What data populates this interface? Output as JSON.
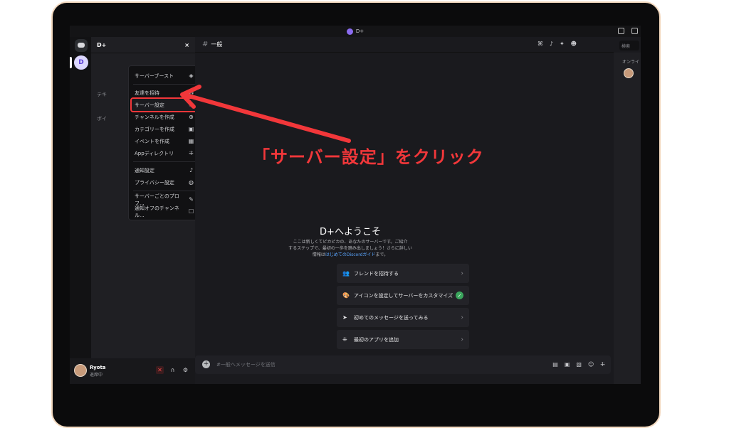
{
  "window": {
    "title": "D+"
  },
  "rail": {
    "server_initial": "D"
  },
  "sidebar": {
    "server_name": "D+",
    "close_glyph": "×",
    "ghost_text_category": "テキ",
    "ghost_text_voice": "ボイ"
  },
  "context_menu": {
    "items": [
      {
        "label": "サーバーブースト",
        "icon": "boost-icon",
        "glyph": "◈"
      },
      {
        "label": "友達を招待",
        "icon": "invite-icon",
        "glyph": "⁂"
      },
      {
        "label": "サーバー設定",
        "icon": "gear-icon",
        "glyph": "⚙"
      },
      {
        "label": "チャンネルを作成",
        "icon": "add-circle-icon",
        "glyph": "⊕"
      },
      {
        "label": "カテゴリーを作成",
        "icon": "folder-plus-icon",
        "glyph": "▣"
      },
      {
        "label": "イベントを作成",
        "icon": "calendar-icon",
        "glyph": "▦"
      },
      {
        "label": "Appディレクトリ",
        "icon": "grid-icon",
        "glyph": "⁜"
      },
      {
        "label": "通知設定",
        "icon": "bell-icon",
        "glyph": "♪"
      },
      {
        "label": "プライバシー設定",
        "icon": "shield-icon",
        "glyph": "◍"
      },
      {
        "label": "サーバーごとのプロフ...",
        "icon": "pencil-icon",
        "glyph": "✎"
      },
      {
        "label": "通知オフのチャンネル...",
        "icon": "checkbox-icon",
        "glyph": "☐"
      }
    ]
  },
  "user": {
    "name": "Ryota",
    "status": "退席中"
  },
  "channel": {
    "name": "一般",
    "hash": "#"
  },
  "header": {
    "search_placeholder": "検索"
  },
  "members": {
    "label": "オンライ"
  },
  "welcome": {
    "title": "D+へようこそ",
    "desc_1": "ここは新しくてピカピカの、あなたのサーバーです。ご紹介",
    "desc_2": "するステップで、最初の一歩を踏み出しましょう！さらに詳しい",
    "desc_3a": "情報は",
    "desc_3_link": "はじめてのDiscordガイド",
    "desc_3b": "まで。",
    "cards": [
      {
        "label": "フレンドを招待する",
        "icon": "invite-icon",
        "glyph": "👥",
        "done": false
      },
      {
        "label": "アイコンを設定してサーバーをカスタマイズ",
        "icon": "palette-icon",
        "glyph": "🎨",
        "done": true
      },
      {
        "label": "初めてのメッセージを送ってみる",
        "icon": "send-icon",
        "glyph": "➤",
        "done": false
      },
      {
        "label": "最初のアプリを追加",
        "icon": "apps-icon",
        "glyph": "⁜",
        "done": false
      }
    ],
    "check_glyph": "✓",
    "chevron_glyph": "›"
  },
  "composer": {
    "placeholder": "#一般へメッセージを送信",
    "plus_glyph": "+"
  },
  "annotation": {
    "text": "「サーバー設定」をクリック"
  },
  "colors": {
    "accent_red": "#f2373a",
    "brand": "#8b6cf0",
    "success": "#3ba55d",
    "link": "#5aa6ff"
  }
}
